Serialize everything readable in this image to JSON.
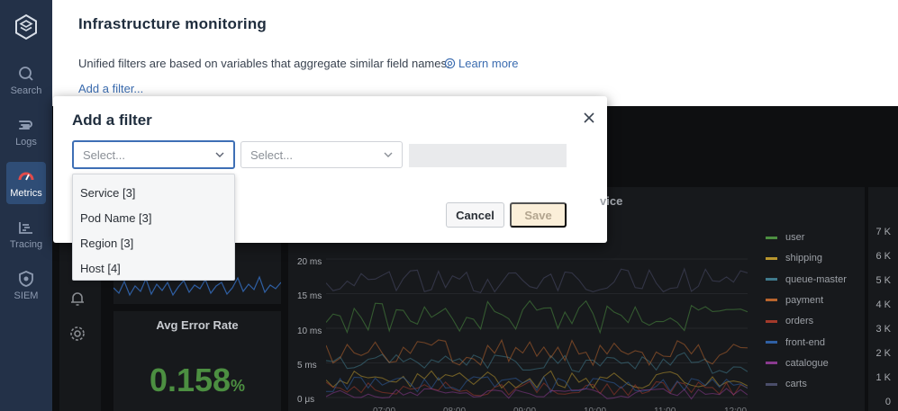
{
  "sidebar": {
    "items": [
      {
        "label": "Search",
        "icon": "search-icon"
      },
      {
        "label": "Logs",
        "icon": "logs-icon"
      },
      {
        "label": "Metrics",
        "icon": "metrics-icon",
        "active": true
      },
      {
        "label": "Tracing",
        "icon": "tracing-icon"
      },
      {
        "label": "SIEM",
        "icon": "siem-icon"
      }
    ]
  },
  "header": {
    "title": "Infrastructure monitoring",
    "info_text": "Unified filters are based on variables that aggregate similar field names.",
    "learn_more": "Learn more",
    "add_filter": "Add a filter..."
  },
  "modal": {
    "title": "Add a filter",
    "field_select_placeholder": "Select...",
    "operator_select_placeholder": "Select...",
    "cancel_label": "Cancel",
    "save_label": "Save",
    "options": [
      "Service [3]",
      "Pod Name [3]",
      "Region [3]",
      "Host [4]"
    ]
  },
  "dashboard": {
    "error_rate_title": "Avg Error Rate",
    "error_rate_value": "0.158",
    "error_rate_unit": "%",
    "latency_panel_title_fragment": "vice",
    "latency_y_ticks": [
      "20 ms",
      "15 ms",
      "10 ms",
      "5 ms",
      "0 μs"
    ],
    "legend": [
      {
        "name": "user",
        "color": "#4c8f41"
      },
      {
        "name": "shipping",
        "color": "#b8952d"
      },
      {
        "name": "queue-master",
        "color": "#3f7a8c"
      },
      {
        "name": "payment",
        "color": "#b8642d"
      },
      {
        "name": "orders",
        "color": "#a33a2b"
      },
      {
        "name": "front-end",
        "color": "#2f5fa3"
      },
      {
        "name": "catalogue",
        "color": "#8a3a8f"
      },
      {
        "name": "carts",
        "color": "#4a4d6a"
      }
    ],
    "right_y_ticks": [
      "7 K",
      "6 K",
      "5 K",
      "4 K",
      "3 K",
      "2 K",
      "1 K",
      "0"
    ],
    "x_ticks": [
      "07:00",
      "08:00",
      "09:00",
      "10:00",
      "11:00",
      "12:00"
    ]
  }
}
